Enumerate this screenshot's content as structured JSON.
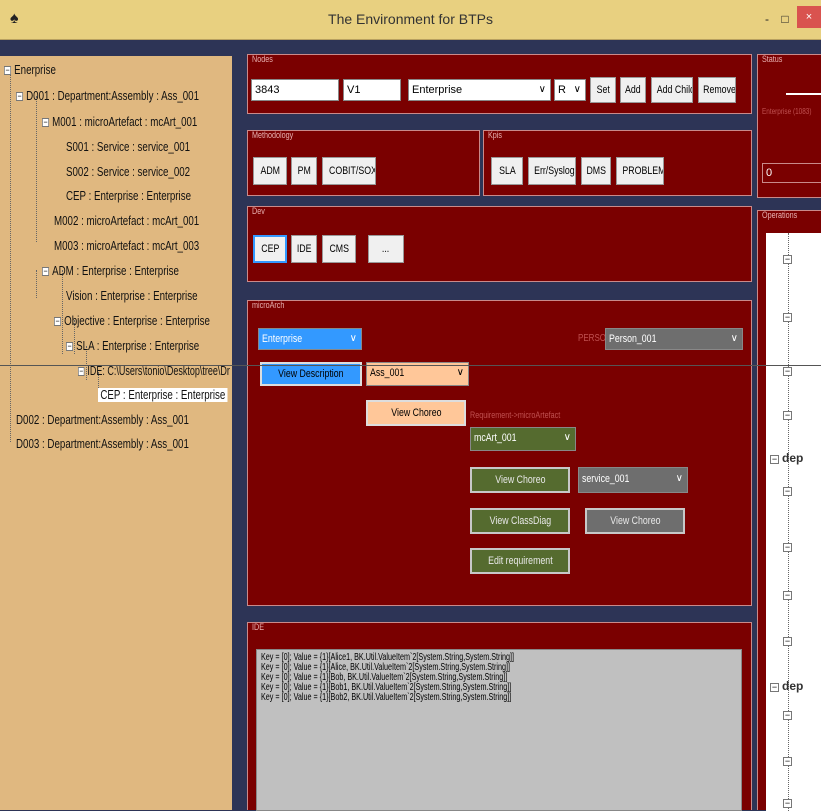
{
  "window": {
    "title": "The Environment for BTPs",
    "minimize": "-",
    "maximize": "□",
    "close": "×"
  },
  "tree": {
    "root": "Enerprise",
    "nodes": [
      "D001 : Department:Assembly : Ass_001",
      "M001 : microArtefact : mcArt_001",
      "S001 : Service : service_001",
      "S002 : Service : service_002",
      "CEP : Enterprise : Enterprise",
      "M002 : microArtefact : mcArt_001",
      "M003 : microArtefact : mcArt_003",
      "ADM : Enterprise : Enterprise",
      "Vision : Enterprise : Enterprise",
      "Objective : Enterprise : Enterprise",
      "SLA : Enterprise : Enterprise",
      "IDE: C:\\Users\\tonio\\Desktop\\tree\\Dr",
      "CEP : Enterprise : Enterprise",
      "D002 : Department:Assembly : Ass_001",
      "D003 : Department:Assembly : Ass_001"
    ]
  },
  "nodes_group": {
    "label": "Nodes",
    "id": "3843",
    "version": "V1",
    "type": "Enterprise",
    "mode": "R",
    "set": "Set",
    "add": "Add",
    "add_child": "Add Child",
    "remove": "Remove"
  },
  "methodology": {
    "label": "Methodology",
    "buttons": [
      "ADM",
      "PM",
      "COBIT/SOX"
    ]
  },
  "kpis": {
    "label": "Kpis",
    "buttons": [
      "SLA",
      "Err/Syslog",
      "DMS",
      "PROBLEM"
    ]
  },
  "dev": {
    "label": "Dev",
    "buttons": [
      "CEP",
      "IDE",
      "CMS",
      "..."
    ]
  },
  "micro": {
    "label": "microArch",
    "enterprise": "Enterprise",
    "person_label": "PERSON",
    "person": "Person_001",
    "view_description": "View Description",
    "assembly": "Ass_001",
    "view_choreo": "View Choreo",
    "req_label": "Requirement->microArtefact",
    "mcart": "mcArt_001",
    "view_choreo2": "View Choreo",
    "service": "service_001",
    "view_classdiag": "View ClassDiag",
    "view_choreo3": "View Choreo",
    "edit_requirement": "Edit requirement"
  },
  "ide": {
    "label": "IDE",
    "lines": [
      "Key = [0]; Value = {1}[Alice1, BK.Util.ValueItem`2[System.String,System.String]]",
      "Key = [0]; Value = {1}[Alice, BK.Util.ValueItem`2[System.String,System.String]]",
      "Key = [0]; Value = {1}[Bob, BK.Util.ValueItem`2[System.String,System.String]]",
      "Key = [0]; Value = {1}[Bob1, BK.Util.ValueItem`2[System.String,System.String]]",
      "Key = [0]; Value = {1}[Bob2, BK.Util.ValueItem`2[System.String,System.String]]"
    ]
  },
  "status": {
    "label": "Status",
    "text": "Enterprise (1083)",
    "value": "0"
  },
  "operations": {
    "label": "Operations",
    "headers": [
      "dep",
      "dep"
    ]
  },
  "colors": {
    "titlebar": "#e8d080",
    "tree_bg": "#e0b880",
    "group_bg": "#7a0000",
    "blue": "#3399ff",
    "peach": "#ffc799",
    "green": "#556b2f",
    "grey": "#6e6e6e"
  }
}
